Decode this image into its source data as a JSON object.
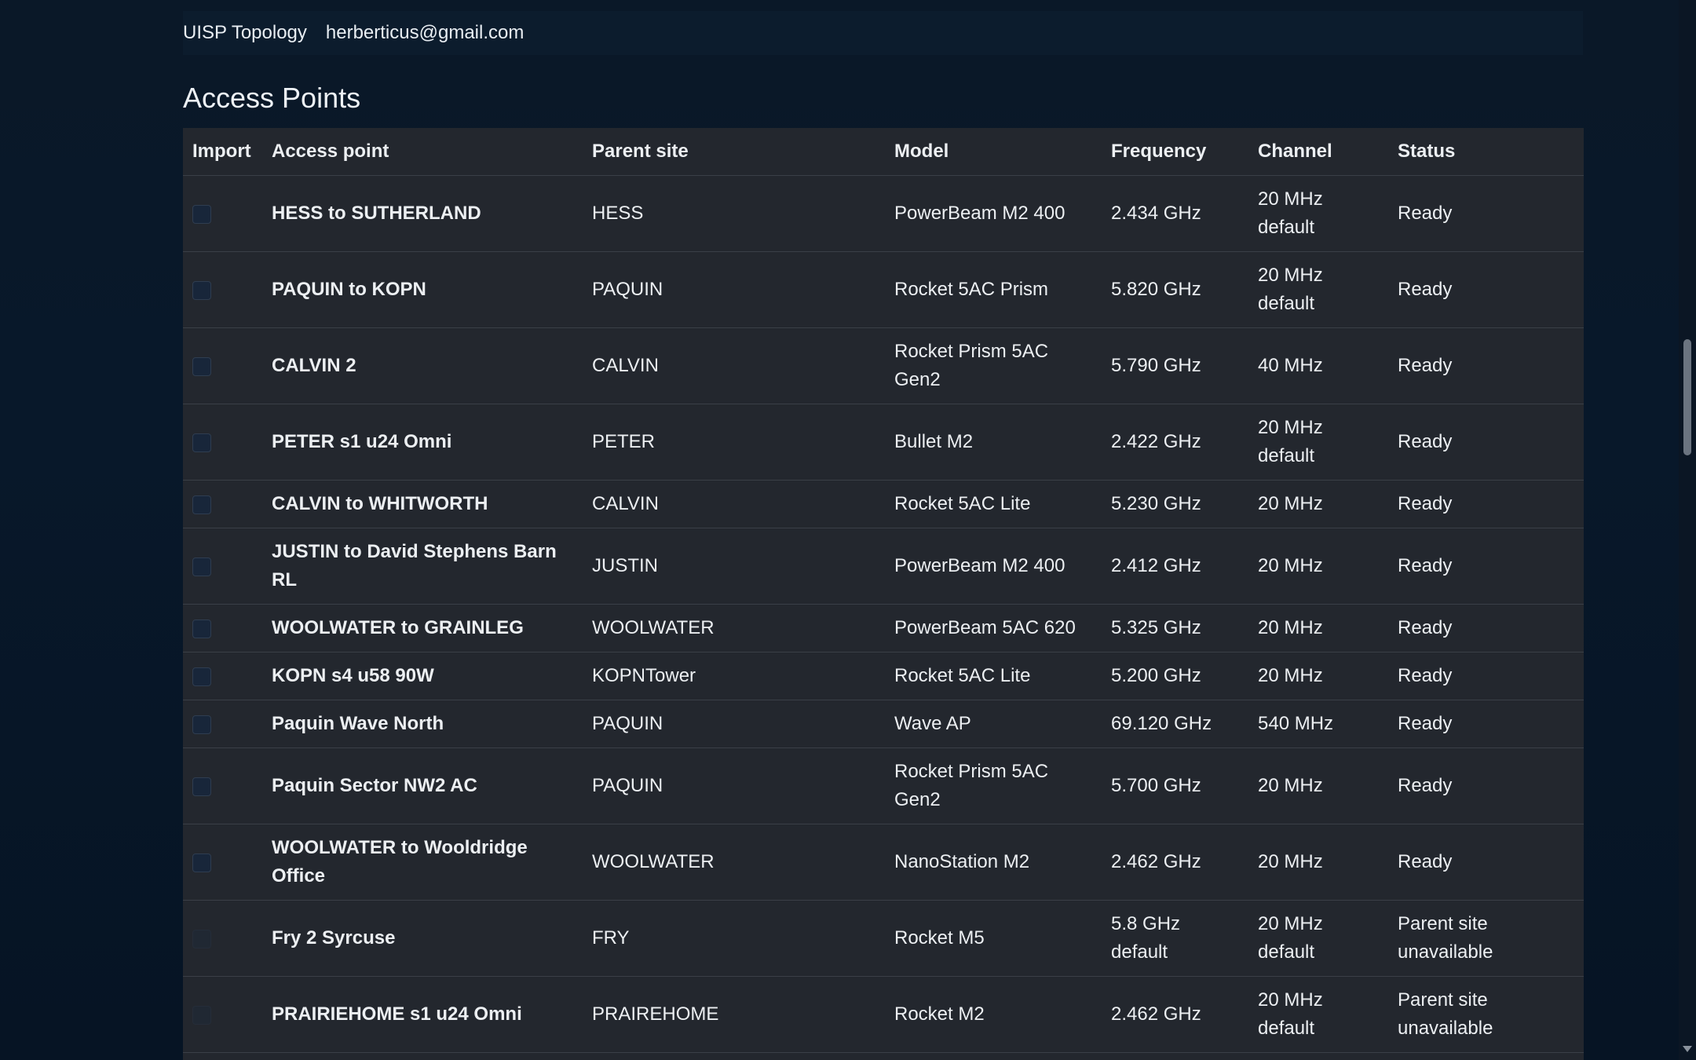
{
  "topbar": {
    "app_name": "UISP Topology",
    "user_email": "herberticus@gmail.com"
  },
  "section_title": "Access Points",
  "table": {
    "headers": {
      "import": "Import",
      "access_point": "Access point",
      "parent_site": "Parent site",
      "model": "Model",
      "frequency": "Frequency",
      "channel": "Channel",
      "status": "Status"
    },
    "rows": [
      {
        "name": "HESS to SUTHERLAND",
        "parent": "HESS",
        "model": "PowerBeam M2 400",
        "frequency": "2.434 GHz",
        "channel": "20 MHz default",
        "status": "Ready",
        "enabled": true
      },
      {
        "name": "PAQUIN to KOPN",
        "parent": "PAQUIN",
        "model": "Rocket 5AC Prism",
        "frequency": "5.820 GHz",
        "channel": "20 MHz default",
        "status": "Ready",
        "enabled": true
      },
      {
        "name": "CALVIN 2",
        "parent": "CALVIN",
        "model": "Rocket Prism 5AC Gen2",
        "frequency": "5.790 GHz",
        "channel": "40 MHz",
        "status": "Ready",
        "enabled": true
      },
      {
        "name": "PETER s1 u24 Omni",
        "parent": "PETER",
        "model": "Bullet M2",
        "frequency": "2.422 GHz",
        "channel": "20 MHz default",
        "status": "Ready",
        "enabled": true
      },
      {
        "name": "CALVIN to WHITWORTH",
        "parent": "CALVIN",
        "model": "Rocket 5AC Lite",
        "frequency": "5.230 GHz",
        "channel": "20 MHz",
        "status": "Ready",
        "enabled": true
      },
      {
        "name": "JUSTIN to David Stephens Barn RL",
        "parent": "JUSTIN",
        "model": "PowerBeam M2 400",
        "frequency": "2.412 GHz",
        "channel": "20 MHz",
        "status": "Ready",
        "enabled": true
      },
      {
        "name": "WOOLWATER to GRAINLEG",
        "parent": "WOOLWATER",
        "model": "PowerBeam 5AC 620",
        "frequency": "5.325 GHz",
        "channel": "20 MHz",
        "status": "Ready",
        "enabled": true
      },
      {
        "name": "KOPN s4 u58 90W",
        "parent": "KOPNTower",
        "model": "Rocket 5AC Lite",
        "frequency": "5.200 GHz",
        "channel": "20 MHz",
        "status": "Ready",
        "enabled": true
      },
      {
        "name": "Paquin Wave North",
        "parent": "PAQUIN",
        "model": "Wave AP",
        "frequency": "69.120 GHz",
        "channel": "540 MHz",
        "status": "Ready",
        "enabled": true
      },
      {
        "name": "Paquin Sector NW2 AC",
        "parent": "PAQUIN",
        "model": "Rocket Prism 5AC Gen2",
        "frequency": "5.700 GHz",
        "channel": "20 MHz",
        "status": "Ready",
        "enabled": true
      },
      {
        "name": "WOOLWATER to Wooldridge Office",
        "parent": "WOOLWATER",
        "model": "NanoStation M2",
        "frequency": "2.462 GHz",
        "channel": "20 MHz",
        "status": "Ready",
        "enabled": true
      },
      {
        "name": "Fry 2 Syrcuse",
        "parent": "FRY",
        "model": "Rocket M5",
        "frequency": "5.8 GHz default",
        "channel": "20 MHz default",
        "status": "Parent site unavailable",
        "enabled": false
      },
      {
        "name": "PRAIRIEHOME s1 u24 Omni",
        "parent": "PRAIREHOME",
        "model": "Rocket M2",
        "frequency": "2.462 GHz",
        "channel": "20 MHz default",
        "status": "Parent site unavailable",
        "enabled": false
      }
    ]
  }
}
